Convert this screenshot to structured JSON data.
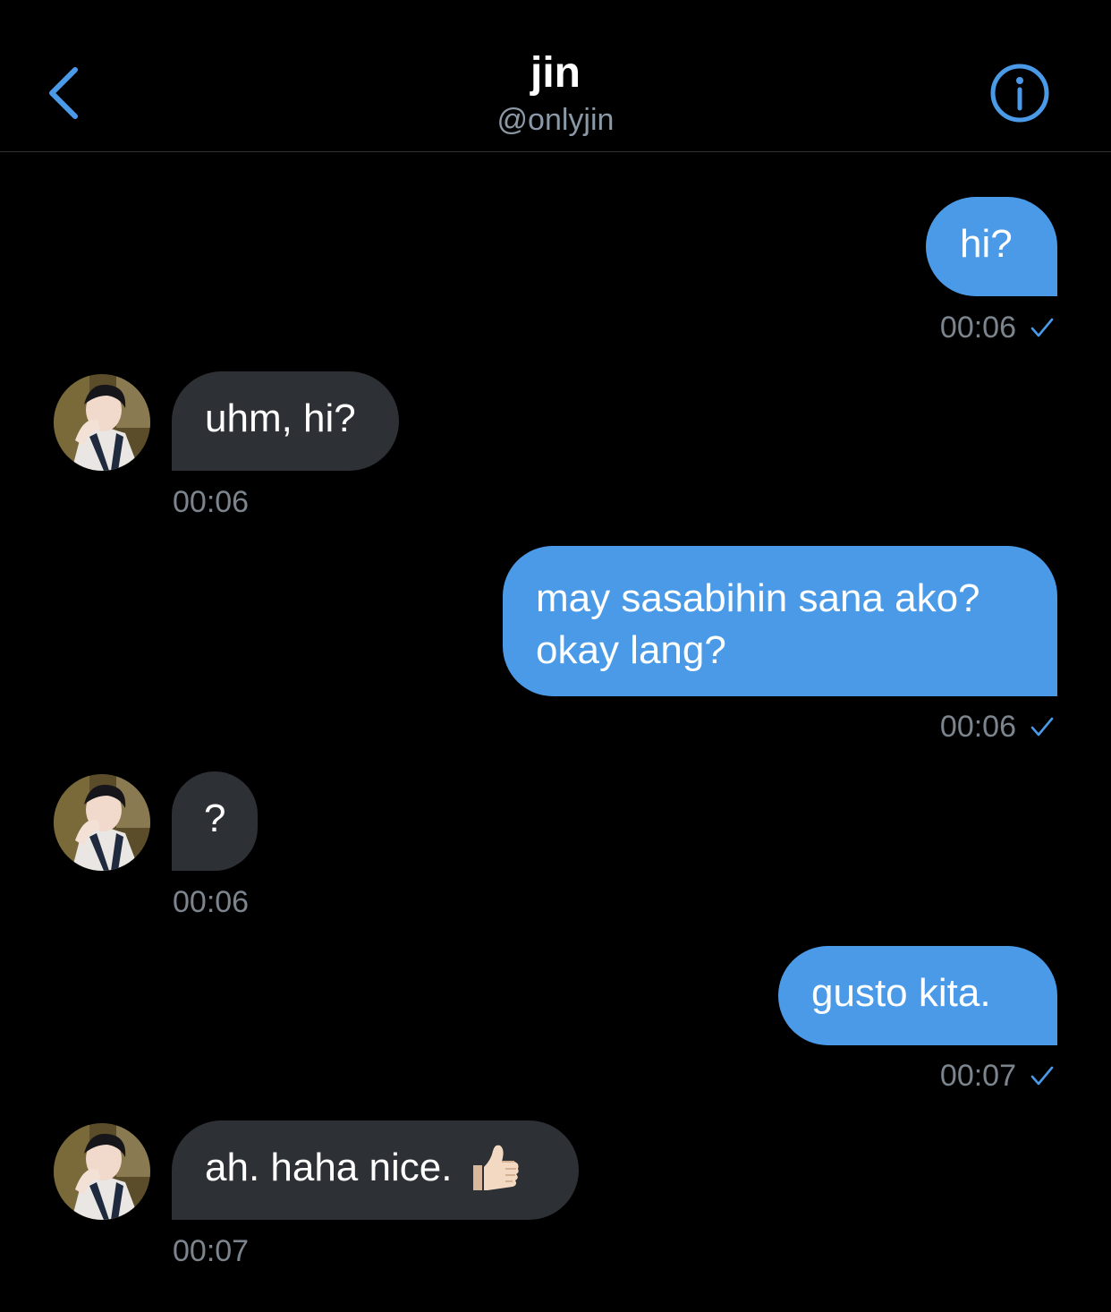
{
  "header": {
    "back_icon": "chevron-left-icon",
    "title": "jin",
    "handle": "@onlyjin",
    "info_icon": "info-circle-icon"
  },
  "colors": {
    "accent": "#4a9ae8",
    "sent_bubble": "#4a9ae8",
    "received_bubble": "#2d3034",
    "timestamp": "#7c858e",
    "background": "#000000"
  },
  "messages": [
    {
      "direction": "sent",
      "text": "hi?",
      "time": "00:06",
      "status_icon": "check-icon"
    },
    {
      "direction": "received",
      "text": "uhm, hi?",
      "time": "00:06",
      "avatar": "avatar-photo"
    },
    {
      "direction": "sent",
      "lines": [
        "may sasabihin sana ako?",
        "okay lang?"
      ],
      "time": "00:06",
      "status_icon": "check-icon"
    },
    {
      "direction": "received",
      "text": "?",
      "time": "00:06",
      "avatar": "avatar-photo"
    },
    {
      "direction": "sent",
      "text": "gusto kita.",
      "time": "00:07",
      "status_icon": "check-icon"
    },
    {
      "direction": "received",
      "text": "ah. haha nice.",
      "emoji": "thumbs-up-icon",
      "time": "00:07",
      "avatar": "avatar-photo"
    }
  ]
}
